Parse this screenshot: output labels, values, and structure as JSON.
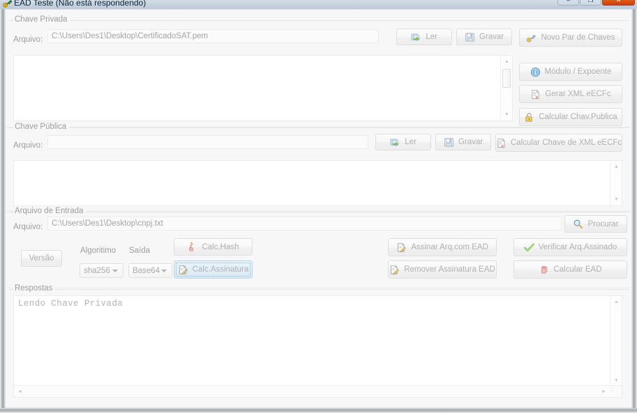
{
  "window": {
    "title": "EAD Teste (Não está respondendo)",
    "app_icon": "key-app-icon",
    "controls": {
      "minimize": "–",
      "maximize": "❐",
      "close": "✕"
    }
  },
  "private_key": {
    "group_label": "Chave Privada",
    "file_label": "Arquivo:",
    "file_value": "C:\\Users\\Des1\\Desktop\\CertificadoSAT.pem",
    "file_placeholder": "",
    "content": "",
    "buttons": {
      "read": "Ler",
      "save": "Gravar",
      "new_pair": "Novo Par de Chaves",
      "modulus_exponent": "Módulo / Expoente",
      "generate_xml": "Gerar XML eECFc",
      "calc_public_key": "Calcular Chav.Publica"
    }
  },
  "public_key": {
    "group_label": "Chave Pública",
    "file_label": "Arquivo:",
    "file_value": "",
    "file_placeholder": "",
    "content": "",
    "buttons": {
      "read": "Ler",
      "save": "Gravar",
      "calc_key_from_xml": "Calcular Chave de XML eECFc"
    }
  },
  "input_file": {
    "group_label": "Arquivo de Entrada",
    "file_label": "Arquivo:",
    "file_value": "C:\\Users\\Des1\\Desktop\\cnpj.txt",
    "file_placeholder": "",
    "browse_button": "Procurar",
    "version_button": "Versão",
    "algorithm_label": "Algoritimo",
    "algorithm_value": "sha256",
    "output_label": "Saída",
    "output_value": "Base64",
    "buttons": {
      "calc_hash": "Calc.Hash",
      "calc_signature": "Calc.Assinatura",
      "sign_file": "Assinar Arq.com EAD",
      "remove_signature": "Remover Assinatura EAD",
      "verify_file": "Verificar Arq.Assinado",
      "calc_ead": "Calcular EAD"
    }
  },
  "responses": {
    "group_label": "Respostas",
    "content": "Lendo Chave Privada"
  },
  "scroll": {
    "up_arrow": "▲",
    "down_arrow": "▼",
    "left_arrow": "◄",
    "right_arrow": "►",
    "grip": "⁞"
  },
  "colors": {
    "accent": "#dbeaf6",
    "close_button": "#e2661a",
    "text_muted": "#9d9d9d"
  }
}
